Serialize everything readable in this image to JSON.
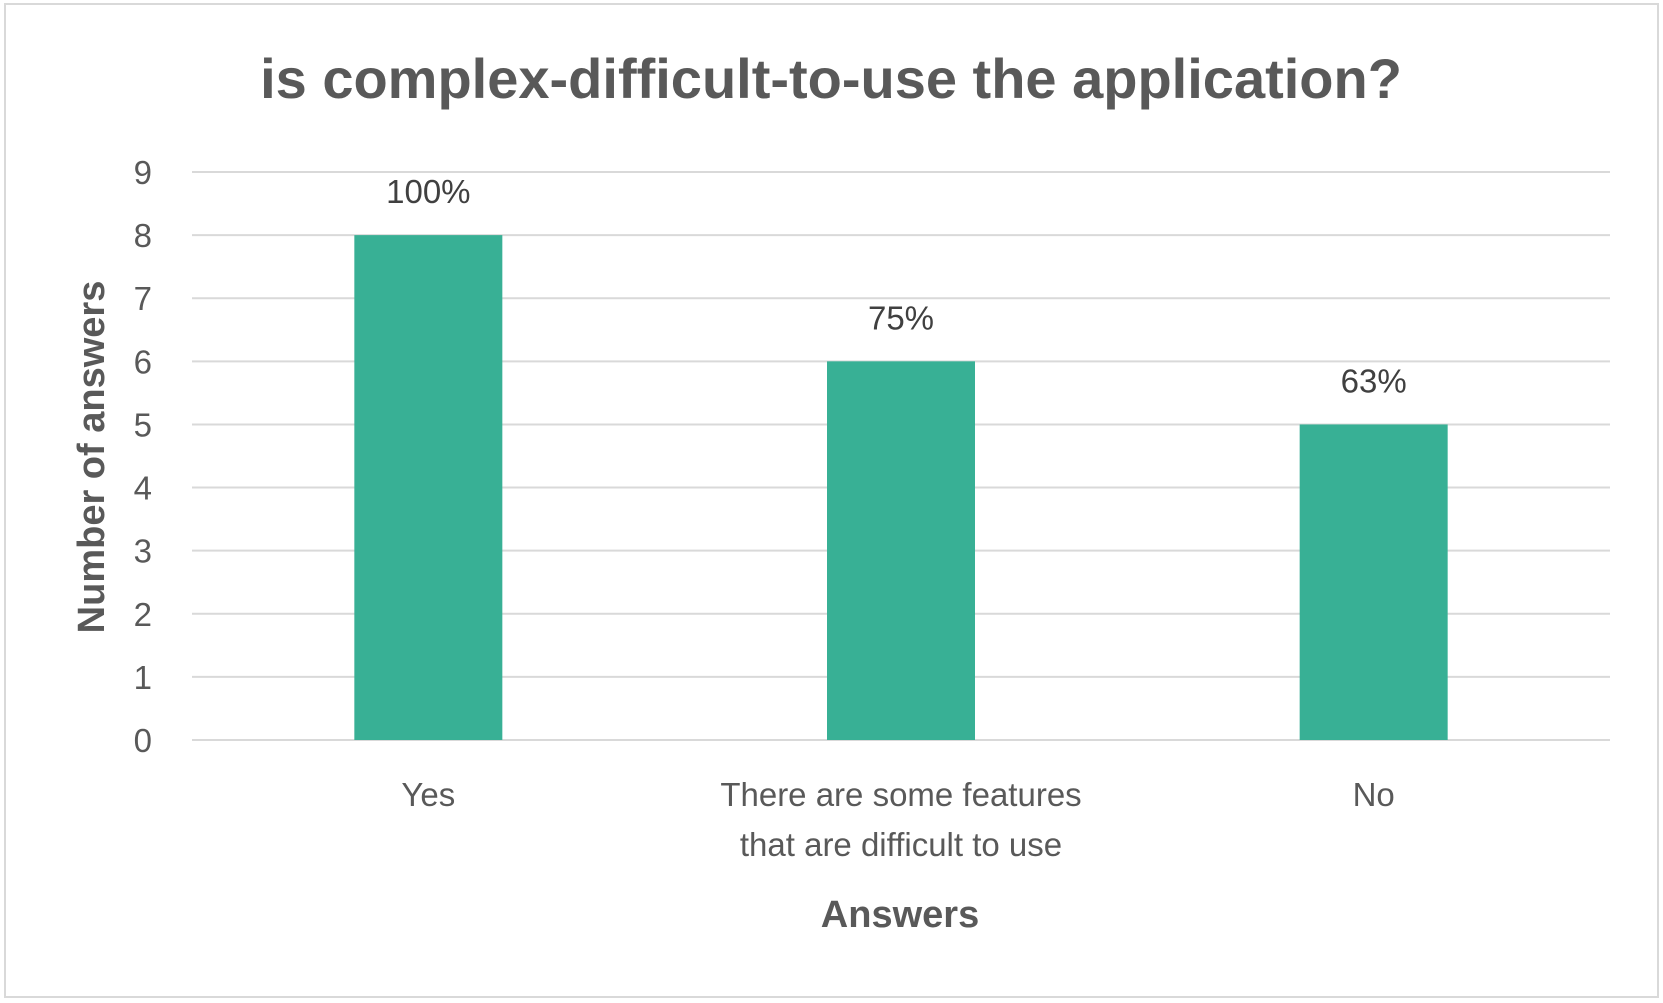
{
  "chart_data": {
    "type": "bar",
    "title": "is complex-difficult-to-use the application?",
    "xlabel": "Answers",
    "ylabel": "Number of answers",
    "categories": [
      [
        "Yes"
      ],
      [
        "There are some features",
        "that are difficult to use"
      ],
      [
        "No"
      ]
    ],
    "values": [
      8,
      6,
      5
    ],
    "data_labels": [
      "100%",
      "75%",
      "63%"
    ],
    "ylim": [
      0,
      9
    ],
    "yticks": [
      0,
      1,
      2,
      3,
      4,
      5,
      6,
      7,
      8,
      9
    ],
    "grid": true,
    "legend": "none",
    "colors": {
      "bar": "#38b095",
      "grid": "#d9d9d9",
      "text": "#595959"
    }
  }
}
